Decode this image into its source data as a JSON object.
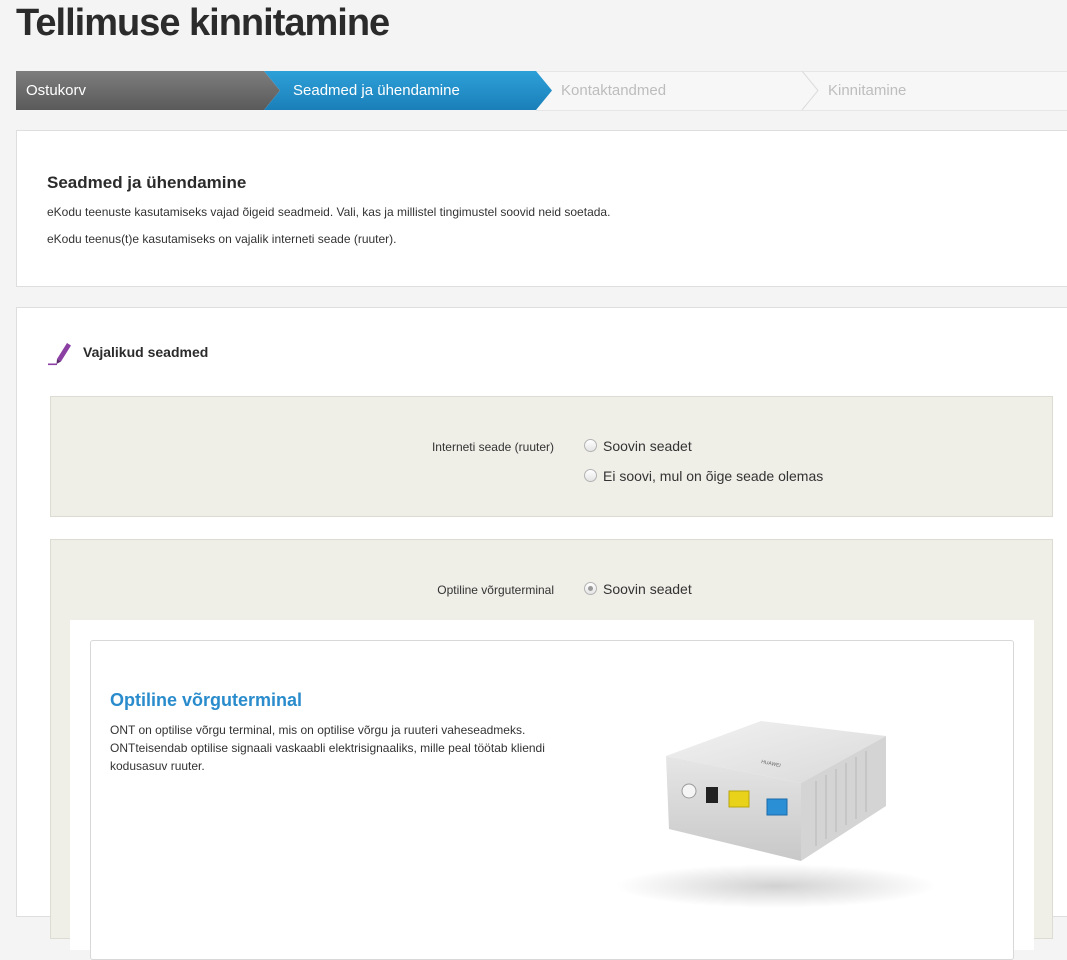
{
  "page": {
    "title": "Tellimuse kinnitamine"
  },
  "stepper": {
    "steps": [
      {
        "label": "Ostukorv",
        "state": "done"
      },
      {
        "label": "Seadmed ja ühendamine",
        "state": "active"
      },
      {
        "label": "Kontaktandmed",
        "state": "upcoming"
      },
      {
        "label": "Kinnitamine",
        "state": "upcoming"
      }
    ]
  },
  "intro": {
    "heading": "Seadmed ja ühendamine",
    "line1": "eKodu teenuste kasutamiseks vajad õigeid seadmeid. Vali, kas ja millistel tingimustel soovid neid soetada.",
    "line2": "eKodu teenus(t)e kasutamiseks on vajalik interneti seade (ruuter)."
  },
  "devices": {
    "heading": "Vajalikud seadmed",
    "heading_icon": "pen-icon",
    "router": {
      "label": "Interneti seade (ruuter)",
      "options": [
        {
          "label": "Soovin seadet",
          "checked": false
        },
        {
          "label": "Ei soovi, mul on õige seade olemas",
          "checked": false
        }
      ]
    },
    "ont": {
      "label": "Optiline võrguterminal",
      "options": [
        {
          "label": "Soovin seadet",
          "checked": true
        }
      ],
      "card": {
        "title": "Optiline võrguterminal",
        "description": "ONT on optilise võrgu terminal, mis on optilise võrgu ja ruuteri vaheseadmeks. ONTteisendab optilise signaali vaskaabli elektrisignaaliks, mille peal töötab kliendi kodusasuv ruuter.",
        "image_brand": "HUAWEI"
      }
    }
  },
  "colors": {
    "active_step": "#1f8cc8",
    "done_step": "#6b6b6b",
    "card_title": "#2a8ccc",
    "option_box": "#efeee7",
    "pen_icon": "#8b3fa3"
  }
}
